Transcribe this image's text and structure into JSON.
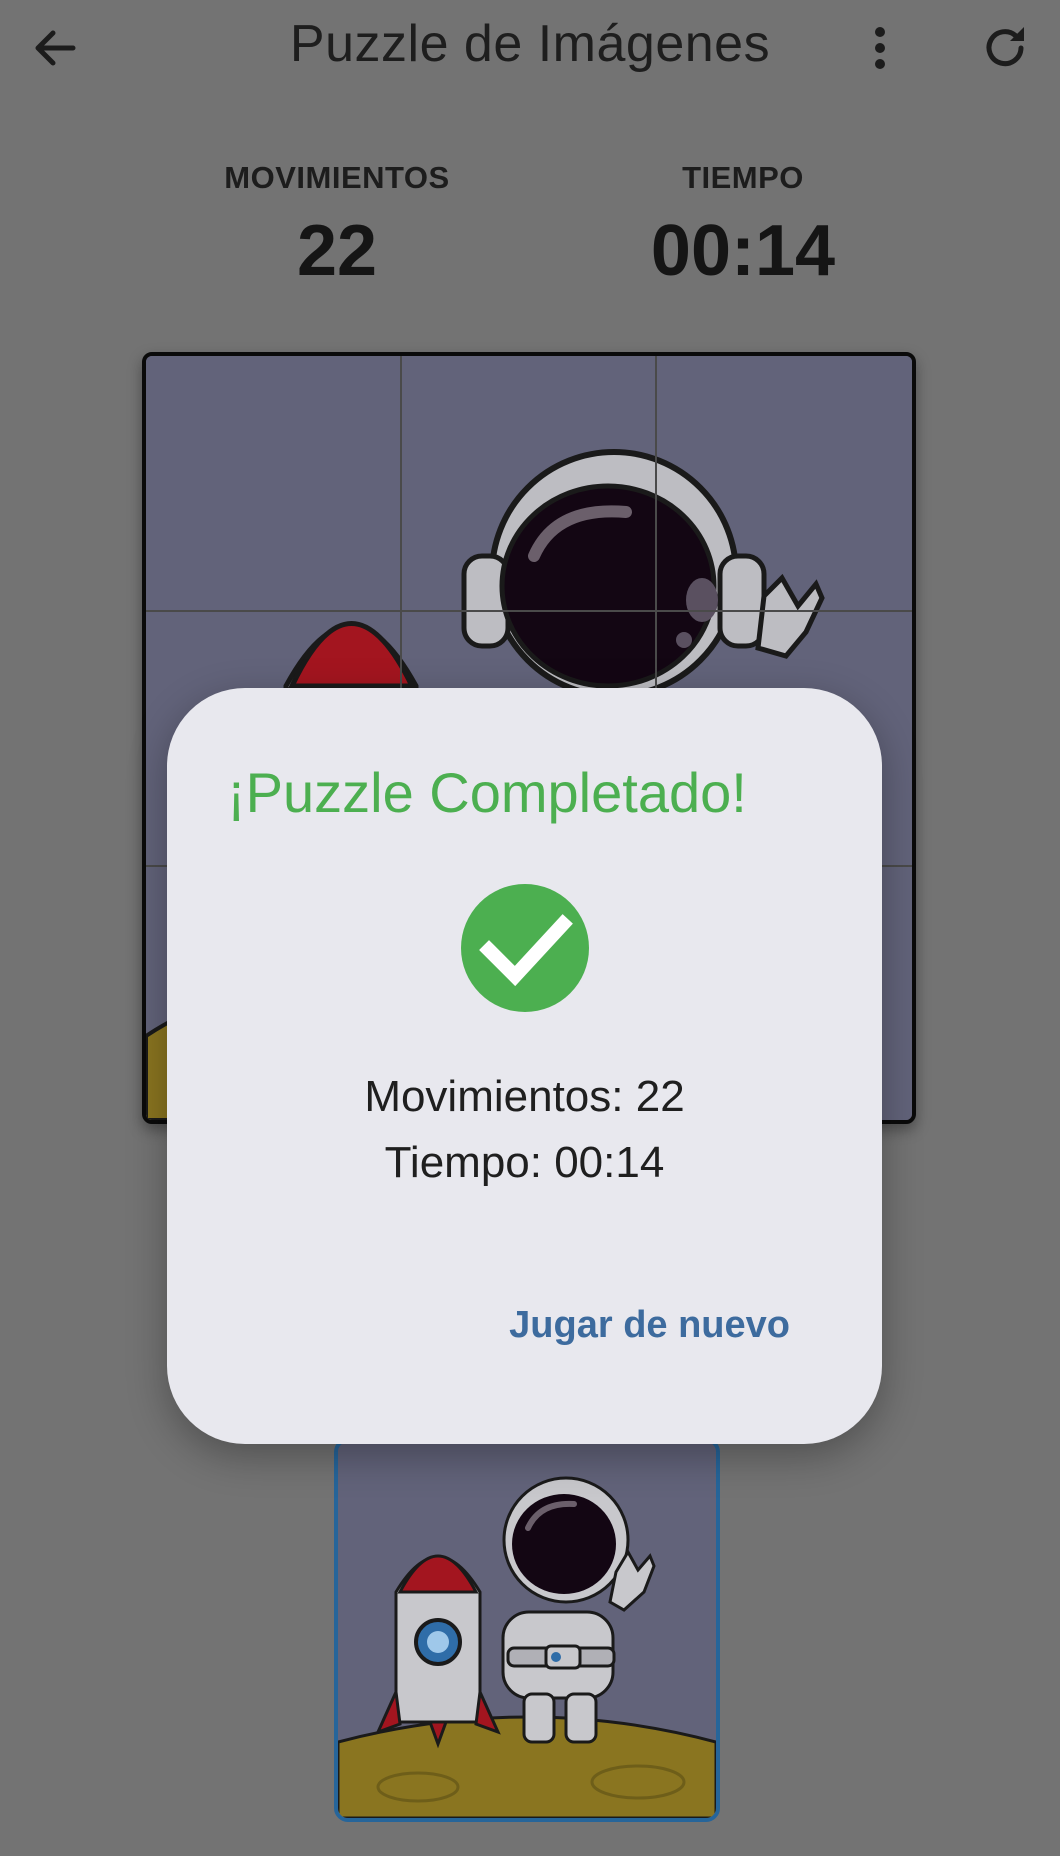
{
  "appbar": {
    "title": "Puzzle de Imágenes",
    "back_icon": "arrow-left-icon",
    "menu_icon": "more-vert-icon",
    "refresh_icon": "refresh-icon"
  },
  "stats": {
    "moves_label": "MOVIMIENTOS",
    "moves_value": "22",
    "time_label": "TIEMPO",
    "time_value": "00:14"
  },
  "board": {
    "rows": 3,
    "cols": 3
  },
  "dialog": {
    "title": "¡Puzzle Completado!",
    "check_icon": "check-circle-icon",
    "moves_text": "Movimientos: 22",
    "time_text": "Tiempo: 00:14",
    "play_again": "Jugar de nuevo"
  },
  "colors": {
    "scrim": "#737373",
    "success": "#4caf50",
    "link": "#3d6b9e",
    "preview_border": "#26659a"
  }
}
